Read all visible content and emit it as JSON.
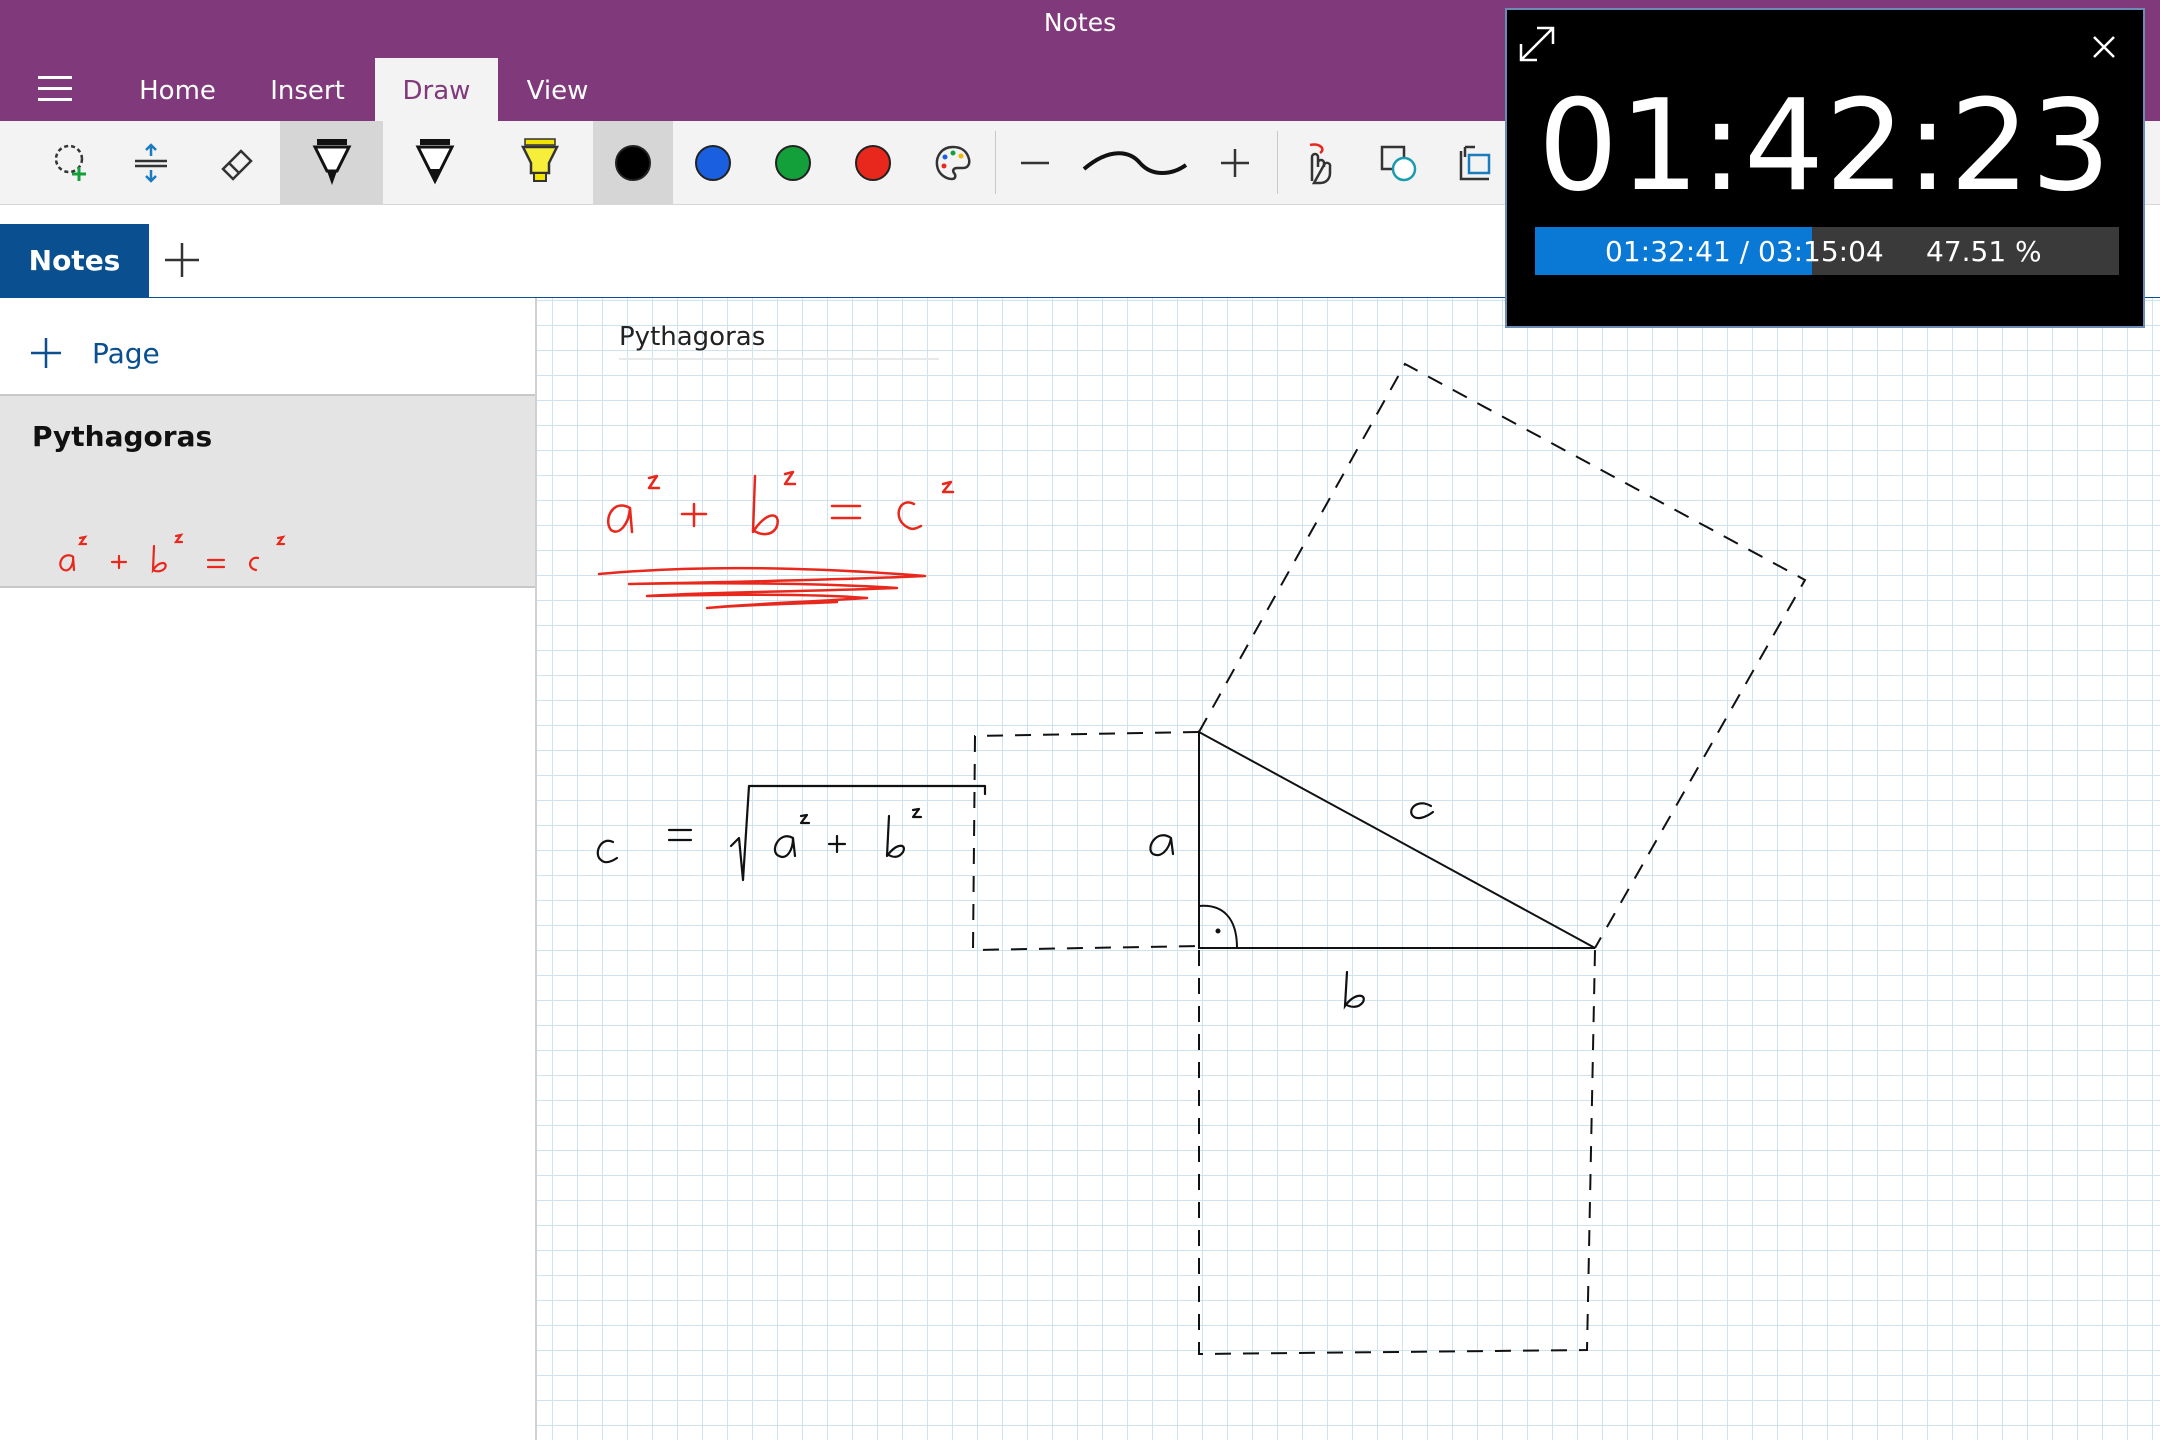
{
  "window": {
    "title": "Notes"
  },
  "ribbon": {
    "tabs": [
      {
        "label": "Home"
      },
      {
        "label": "Insert"
      },
      {
        "label": "Draw"
      },
      {
        "label": "View"
      }
    ],
    "active_tab": "Draw"
  },
  "toolbar": {
    "tools": [
      "lasso-select-icon",
      "insert-space-icon",
      "eraser-icon",
      "pen-icon",
      "pencil-icon",
      "highlighter-icon"
    ],
    "colors": [
      "#000000",
      "#1a5fe0",
      "#13a03a",
      "#e8281c"
    ],
    "selected_color": "#000000",
    "more_colors": "color-palette-icon",
    "thickness": [
      "minus-icon",
      "stroke-preview-icon",
      "plus-icon"
    ],
    "extras": [
      "touch-draw-icon",
      "shapes-icon",
      "ink-to-text-icon"
    ]
  },
  "sections": {
    "items": [
      {
        "label": "Notes"
      }
    ],
    "add_icon": "plus-icon"
  },
  "sidebar": {
    "add_page_label": "Page",
    "pages": [
      {
        "title": "Pythagoras"
      }
    ]
  },
  "canvas": {
    "page_title": "Pythagoras"
  },
  "timer": {
    "time": "01:42:23",
    "progress_text": "01:32:41 / 03:15:04",
    "percent_text": "47.51 %",
    "progress": 0.4751
  },
  "colors": {
    "title_bar": "#80397b",
    "section_accent": "#0a4f8f",
    "ink_red": "#e8281c"
  }
}
